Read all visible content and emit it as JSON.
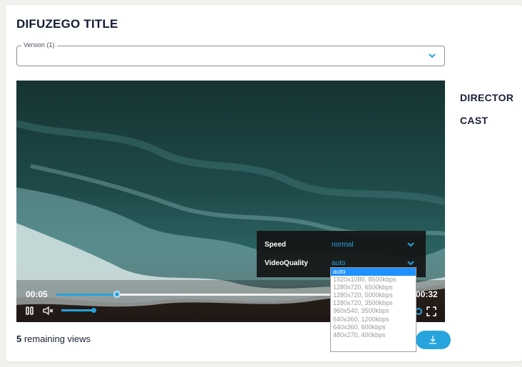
{
  "title": "DIFUZEGO TITLE",
  "version_select": {
    "label": "Version (1)",
    "value": "",
    "chevron": "chevron-down-icon"
  },
  "details": {
    "director_label": "DIRECTOR",
    "cast_label": "CAST"
  },
  "player": {
    "current_time": "00:05",
    "duration": "00:32",
    "progress_fraction": 0.17,
    "volume_fraction": 1.0,
    "icons": {
      "play_pause": "pause-icon",
      "mute": "volume-mute-icon",
      "fullscreen": "fullscreen-icon",
      "settings": "gear-icon"
    },
    "settings_menu": {
      "speed_label": "Speed",
      "speed_value": "normal",
      "quality_label": "VideoQuality",
      "quality_value": "auto"
    },
    "quality_options": [
      "auto",
      "1920x1080, 8500kbps",
      "1280x720, 6500kbps",
      "1280x720, 5000kbps",
      "1280x720, 3500kbps",
      "960x540, 3500kbps",
      "640x360, 1200kbps",
      "640x360, 600kbps",
      "480x270, 400kbps"
    ],
    "selected_quality_index": 0
  },
  "footer": {
    "views_count": "5",
    "views_text": " remaining views",
    "download_icon": "download-icon"
  },
  "colors": {
    "accent": "#27a3dd",
    "title": "#141c35",
    "page_bg": "#f3f1ee"
  }
}
